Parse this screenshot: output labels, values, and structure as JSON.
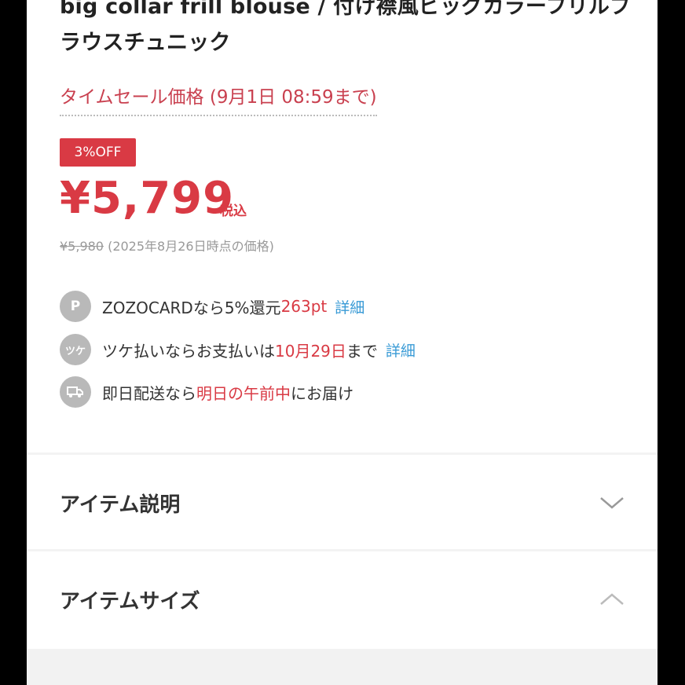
{
  "product": {
    "title": "big collar frill blouse / 付け襟風ビッグカラーフリルブラウスチュニック"
  },
  "sale": {
    "label": "タイムセール価格 (9月1日 08:59まで)",
    "badge": "3%OFF",
    "price": "¥5,799",
    "tax_label": "税込",
    "original_price": "¥5,980",
    "original_note": "(2025年8月26日時点の価格)"
  },
  "perks": [
    {
      "icon": "P",
      "icon_name": "points-icon",
      "text_before": "ZOZOCARDなら5%還元 ",
      "highlight": "263pt",
      "text_after": "",
      "link": "詳細"
    },
    {
      "icon": "ツケ",
      "icon_name": "tsuke-payment-icon",
      "text_before": "ツケ払いならお支払いは",
      "highlight": "10月29日",
      "text_after": "まで",
      "link": "詳細"
    },
    {
      "icon": "⛟",
      "icon_name": "delivery-truck-icon",
      "text_before": "即日配送なら",
      "highlight": "明日の午前中",
      "text_after": "にお届け",
      "link": ""
    }
  ],
  "sections": [
    {
      "label": "アイテム説明",
      "state": "collapsed"
    },
    {
      "label": "アイテムサイズ",
      "state": "expanded"
    }
  ],
  "colors": {
    "accent_red": "#d93a44",
    "link_blue": "#3a9bd6",
    "icon_gray": "#b9b9b9"
  }
}
